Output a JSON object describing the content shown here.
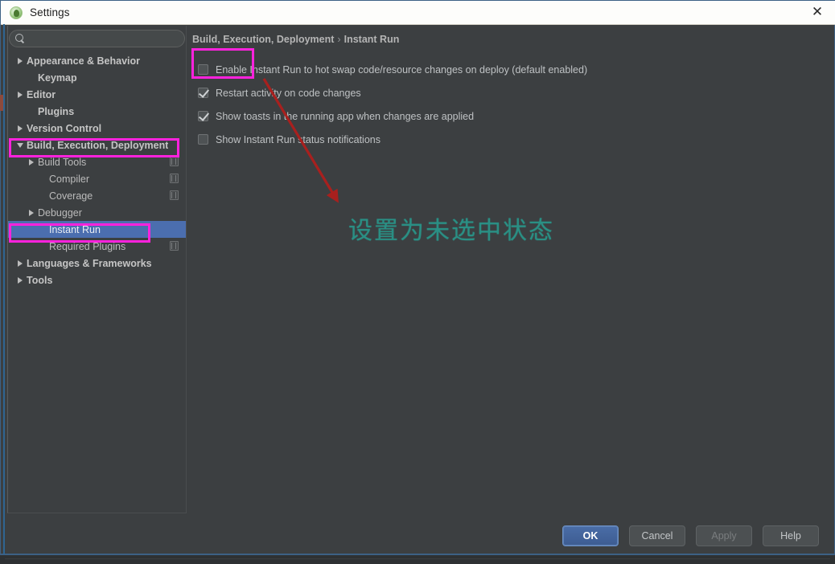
{
  "window": {
    "title": "Settings",
    "app_icon": "android-studio-icon",
    "close_icon": "close-icon"
  },
  "search": {
    "icon": "search-icon",
    "value": "",
    "placeholder": ""
  },
  "sidebar": {
    "items": [
      {
        "label": "Appearance & Behavior",
        "arrow": "right",
        "bold": true,
        "indent": 0,
        "scope_icon": false,
        "selected": false
      },
      {
        "label": "Keymap",
        "arrow": "none",
        "bold": true,
        "indent": 1,
        "scope_icon": false,
        "selected": false
      },
      {
        "label": "Editor",
        "arrow": "right",
        "bold": true,
        "indent": 0,
        "scope_icon": false,
        "selected": false
      },
      {
        "label": "Plugins",
        "arrow": "none",
        "bold": true,
        "indent": 1,
        "scope_icon": false,
        "selected": false
      },
      {
        "label": "Version Control",
        "arrow": "right",
        "bold": true,
        "indent": 0,
        "scope_icon": false,
        "selected": false
      },
      {
        "label": "Build, Execution, Deployment",
        "arrow": "down",
        "bold": true,
        "indent": 0,
        "scope_icon": false,
        "selected": false
      },
      {
        "label": "Build Tools",
        "arrow": "right",
        "bold": false,
        "indent": 1,
        "scope_icon": true,
        "selected": false
      },
      {
        "label": "Compiler",
        "arrow": "none",
        "bold": false,
        "indent": 2,
        "scope_icon": true,
        "selected": false
      },
      {
        "label": "Coverage",
        "arrow": "none",
        "bold": false,
        "indent": 2,
        "scope_icon": true,
        "selected": false
      },
      {
        "label": "Debugger",
        "arrow": "right",
        "bold": false,
        "indent": 1,
        "scope_icon": false,
        "selected": false
      },
      {
        "label": "Instant Run",
        "arrow": "none",
        "bold": false,
        "indent": 2,
        "scope_icon": false,
        "selected": true
      },
      {
        "label": "Required Plugins",
        "arrow": "none",
        "bold": false,
        "indent": 2,
        "scope_icon": true,
        "selected": false
      },
      {
        "label": "Languages & Frameworks",
        "arrow": "right",
        "bold": true,
        "indent": 0,
        "scope_icon": false,
        "selected": false
      },
      {
        "label": "Tools",
        "arrow": "right",
        "bold": true,
        "indent": 0,
        "scope_icon": false,
        "selected": false
      }
    ]
  },
  "content": {
    "breadcrumb_parent": "Build, Execution, Deployment",
    "breadcrumb_separator": "›",
    "breadcrumb_current": "Instant Run",
    "options": [
      {
        "label": "Enable Instant Run to hot swap code/resource changes on deploy (default enabled)",
        "checked": false
      },
      {
        "label": "Restart activity on code changes",
        "checked": true
      },
      {
        "label": "Show toasts in the running app when changes are applied",
        "checked": true
      },
      {
        "label": "Show Instant Run status notifications",
        "checked": false
      }
    ]
  },
  "annotations": {
    "note_text": "设置为未选中状态",
    "note_color": "#2a8f84",
    "highlight_color": "#ff22dd",
    "arrow_color": "#a8201e"
  },
  "footer": {
    "buttons": [
      {
        "label": "OK",
        "style": "default"
      },
      {
        "label": "Cancel",
        "style": "normal"
      },
      {
        "label": "Apply",
        "style": "disabled"
      },
      {
        "label": "Help",
        "style": "normal"
      }
    ]
  }
}
